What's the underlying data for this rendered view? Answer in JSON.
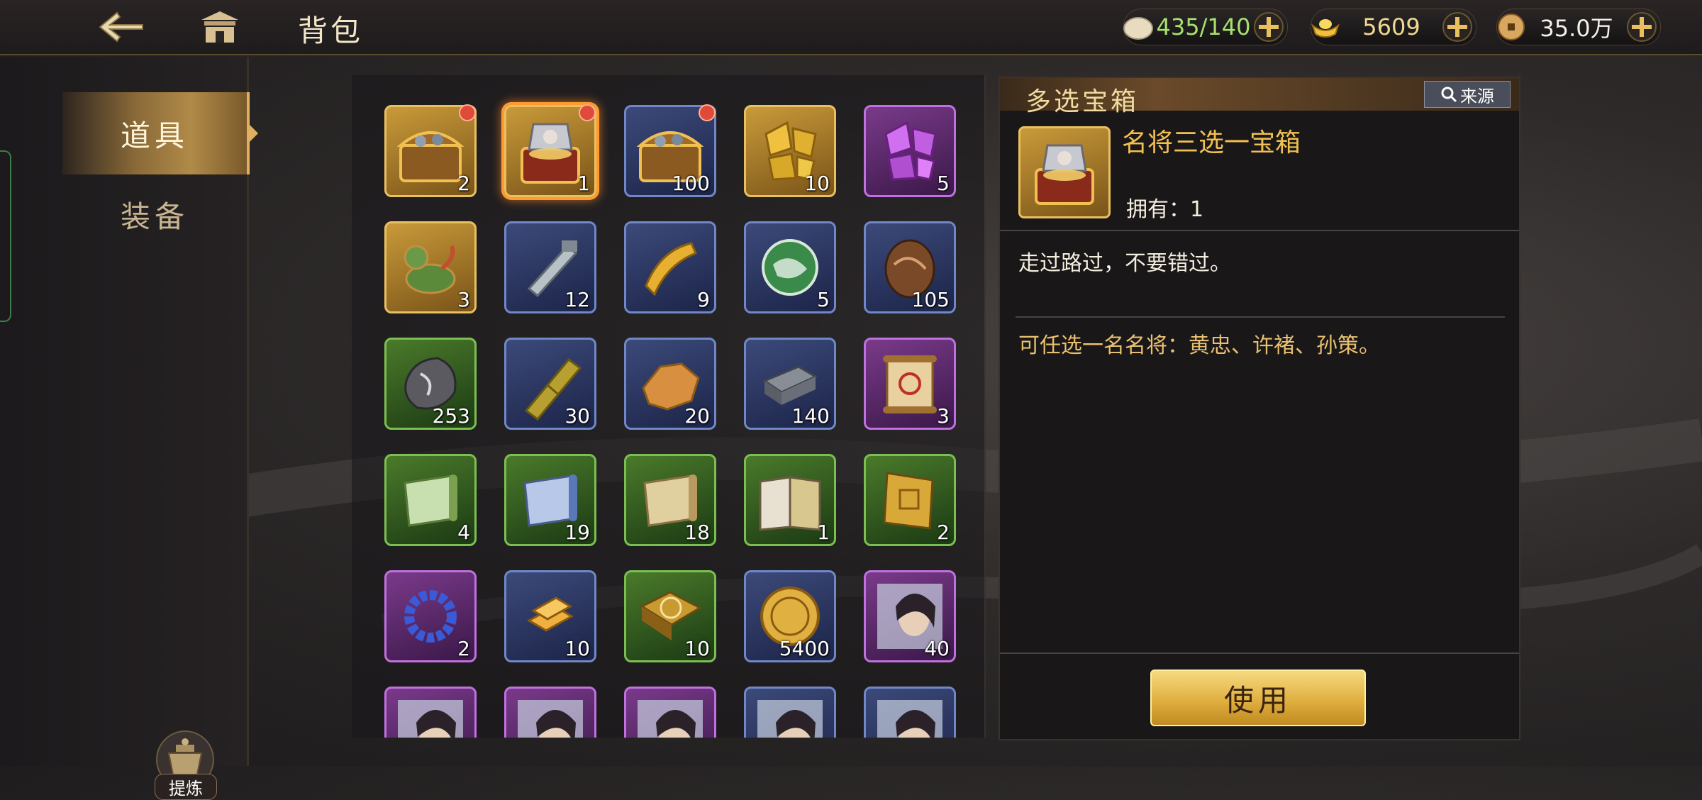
{
  "header": {
    "title": "背包",
    "resources": [
      {
        "icon": "bun-icon",
        "value": "435/140"
      },
      {
        "icon": "gold-ingot-icon",
        "value": "5609"
      },
      {
        "icon": "copper-coin-icon",
        "value": "35.0万"
      }
    ]
  },
  "sidebar": {
    "tabs": [
      {
        "label": "道具",
        "active": true
      },
      {
        "label": "装备",
        "active": false
      }
    ],
    "refine_label": "提炼"
  },
  "grid": {
    "items": [
      {
        "qty": "2",
        "rarity": "gold",
        "icon": "treasure-chest-icon",
        "badge": true
      },
      {
        "qty": "1",
        "rarity": "gold",
        "icon": "general-chest-icon",
        "badge": true,
        "selected": true
      },
      {
        "qty": "100",
        "rarity": "blue",
        "icon": "treasure-chest-icon",
        "badge": true
      },
      {
        "qty": "10",
        "rarity": "gold",
        "icon": "gold-crystal-icon"
      },
      {
        "qty": "5",
        "rarity": "purple",
        "icon": "purple-crystal-icon"
      },
      {
        "qty": "3",
        "rarity": "gold",
        "icon": "pixiu-statue-icon"
      },
      {
        "qty": "12",
        "rarity": "blue",
        "icon": "silver-tool-icon"
      },
      {
        "qty": "9",
        "rarity": "blue",
        "icon": "gold-cloth-icon"
      },
      {
        "qty": "5",
        "rarity": "blue",
        "icon": "jade-orb-icon"
      },
      {
        "qty": "105",
        "rarity": "blue",
        "icon": "bronze-egg-icon"
      },
      {
        "qty": "253",
        "rarity": "green",
        "icon": "iron-ore-icon"
      },
      {
        "qty": "30",
        "rarity": "blue",
        "icon": "bamboo-icon"
      },
      {
        "qty": "20",
        "rarity": "blue",
        "icon": "hide-icon"
      },
      {
        "qty": "140",
        "rarity": "blue",
        "icon": "iron-ingot-icon"
      },
      {
        "qty": "3",
        "rarity": "purple",
        "icon": "scroll-icon"
      },
      {
        "qty": "4",
        "rarity": "green",
        "icon": "green-scroll-icon"
      },
      {
        "qty": "19",
        "rarity": "green",
        "icon": "blue-scroll-icon"
      },
      {
        "qty": "18",
        "rarity": "green",
        "icon": "tan-scroll-icon"
      },
      {
        "qty": "1",
        "rarity": "green",
        "icon": "open-book-icon"
      },
      {
        "qty": "2",
        "rarity": "green",
        "icon": "gold-book-icon"
      },
      {
        "qty": "2",
        "rarity": "purple",
        "icon": "bead-bracelet-icon"
      },
      {
        "qty": "10",
        "rarity": "blue",
        "icon": "gold-bars-icon"
      },
      {
        "qty": "10",
        "rarity": "green",
        "icon": "talisman-map-icon"
      },
      {
        "qty": "5400",
        "rarity": "blue",
        "icon": "prayer-coin-icon"
      },
      {
        "qty": "40",
        "rarity": "purple",
        "icon": "hero-portrait-icon"
      },
      {
        "qty": "",
        "rarity": "purple",
        "icon": "hero-portrait-icon"
      },
      {
        "qty": "",
        "rarity": "purple",
        "icon": "hero-portrait-icon"
      },
      {
        "qty": "",
        "rarity": "purple",
        "icon": "hero-portrait-icon"
      },
      {
        "qty": "",
        "rarity": "blue",
        "icon": "hero-portrait-icon"
      },
      {
        "qty": "",
        "rarity": "blue",
        "icon": "hero-portrait-icon"
      }
    ]
  },
  "detail": {
    "header": "多选宝箱",
    "source_label": "来源",
    "item_name": "名将三选一宝箱",
    "owned": "拥有：1",
    "desc": "走过路过，不要错过。",
    "effect": "可任选一名名将：黄忠、许褚、孙策。",
    "use_label": "使用"
  }
}
